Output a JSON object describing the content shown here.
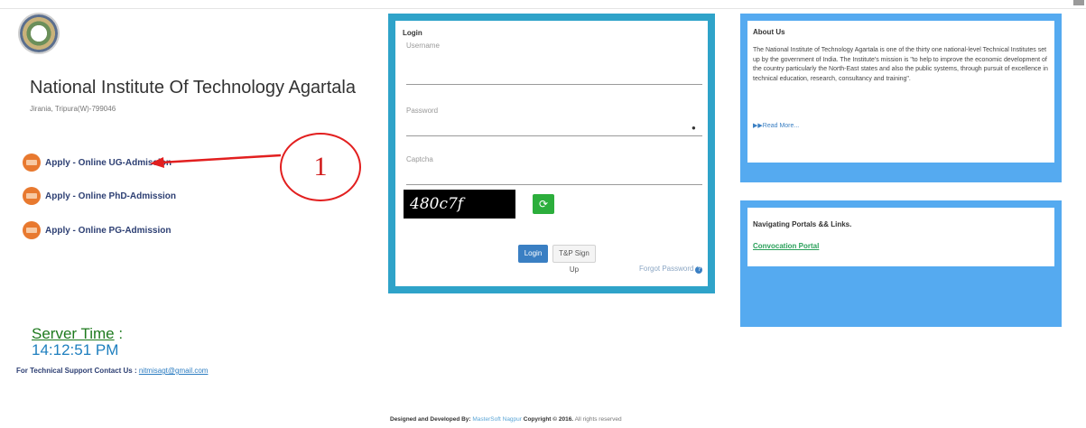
{
  "institute": {
    "name": "National Institute Of Technology Agartala",
    "address": "Jirania, Tripura(W)-799046"
  },
  "apply_links": [
    {
      "label": "Apply - Online UG-Admission"
    },
    {
      "label": "Apply - Online PhD-Admission"
    },
    {
      "label": "Apply - Online PG-Admission"
    }
  ],
  "annotation": {
    "number": "1"
  },
  "server": {
    "label": "Server Time",
    "colon": " :",
    "time": "14:12:51 PM"
  },
  "support": {
    "label": "For Technical Support Contact Us : ",
    "email": "nitmisagt@gmail.com"
  },
  "login": {
    "title": "Login",
    "username_label": "Username",
    "password_label": "Password",
    "captcha_label": "Captcha",
    "captcha_code": "480c7f",
    "login_button": "Login",
    "signup_button": "T&P Sign Up",
    "forgot_password": "Forgot Password"
  },
  "about": {
    "title": "About Us",
    "text": "The National Institute of Technology Agartala is one of the thirty one national-level Technical Institutes set up by the government of India. The Institute's mission is \"to help to improve the economic development of the country particularly the North-East states and also the public systems, through pursuit of excellence in technical education, research, consultancy and training\".",
    "read_more": "Read More..."
  },
  "navigating": {
    "title": "Navigating Portals && Links.",
    "link": "Convocation Portal"
  },
  "footer": {
    "designed_by": "Designed and Developed By: ",
    "company": "MasterSoft Nagpur",
    "copyright": " Copyright © 2016.",
    "rights": " All rights reserved"
  },
  "colors": {
    "login_border": "#2fa3c9",
    "side_panel": "#55aaf0",
    "annotation": "#e21f1f",
    "server_time": "#1e7fbf",
    "apply_badge": "#e8792f"
  }
}
